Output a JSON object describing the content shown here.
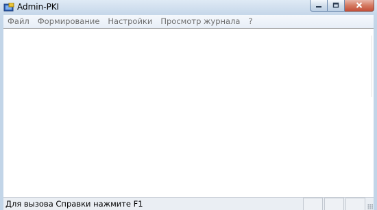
{
  "window": {
    "title": "Admin-PKI"
  },
  "menu": {
    "items": [
      {
        "label": "Файл"
      },
      {
        "label": "Формирование"
      },
      {
        "label": "Настройки"
      },
      {
        "label": "Просмотр журнала"
      },
      {
        "label": "?"
      }
    ]
  },
  "statusbar": {
    "text": "Для вызова Справки нажмите F1"
  },
  "icons": {
    "app": "app-icon",
    "minimize": "minimize-icon",
    "maximize": "maximize-icon",
    "close": "close-icon"
  }
}
